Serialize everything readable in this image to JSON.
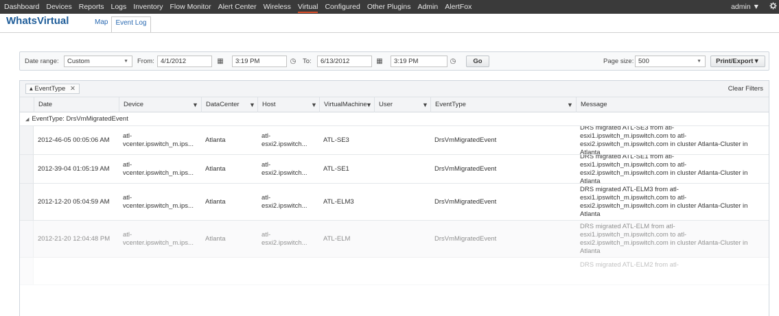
{
  "nav": {
    "items": [
      "Dashboard",
      "Devices",
      "Reports",
      "Logs",
      "Inventory",
      "Flow Monitor",
      "Alert Center",
      "Wireless",
      "Virtual",
      "Configured",
      "Other Plugins",
      "Admin",
      "AlertFox"
    ],
    "active_index": 8,
    "user": "admin ▼",
    "settings_icon": "gear-icon"
  },
  "header": {
    "brand": "WhatsVirtual",
    "tabs": [
      "Map",
      "Event Log"
    ],
    "active_tab": 1
  },
  "toolbar": {
    "date_range_label": "Date range:",
    "date_range_value": "Custom",
    "from_label": "From:",
    "from_date": "4/1/2012",
    "from_time": "3:19 PM",
    "to_label": "To:",
    "to_date": "6/13/2012",
    "to_time": "3:19 PM",
    "go_label": "Go",
    "page_size_label": "Page size:",
    "page_size_value": "500",
    "print_export_label": "Print/Export▼"
  },
  "grid": {
    "group_chip": "EventType",
    "group_chip_prefix": "▴",
    "group_chip_close": "✕",
    "clear_filters": "Clear Filters",
    "columns": [
      "Date",
      "Device",
      "DataCenter",
      "Host",
      "VirtualMachine",
      "User",
      "EventType",
      "Message"
    ],
    "group_label": "EventType: DrsVmMigratedEvent",
    "rows": [
      {
        "date": "2012-46-05 00:05:06 AM",
        "device_line1": "atl-",
        "device_line2": "vcenter.ipswitch_m.ips...",
        "datacenter": "Atlanta",
        "host_line1": "atl-",
        "host_line2": "esxi2.ipswitch...",
        "vm": "ATL-SE3",
        "user": "",
        "eventtype": "DrsVmMigratedEvent",
        "message": "DRS migrated ATL-SE3 from atl-esxi1.ipswitch_m.ipswitch.com to atl-esxi2.ipswitch_m.ipswitch.com in cluster Atlanta-Cluster in Atlanta"
      },
      {
        "date": "2012-39-04 01:05:19 AM",
        "device_line1": "atl-",
        "device_line2": "vcenter.ipswitch_m.ips...",
        "datacenter": "Atlanta",
        "host_line1": "atl-",
        "host_line2": "esxi2.ipswitch...",
        "vm": "ATL-SE1",
        "user": "",
        "eventtype": "DrsVmMigratedEvent",
        "message": "DRS migrated ATL-SE1 from atl-esxi1.ipswitch_m.ipswitch.com to atl-esxi2.ipswitch_m.ipswitch.com in cluster Atlanta-Cluster in Atlanta"
      },
      {
        "date": "2012-12-20 05:04:59 AM",
        "device_line1": "atl-",
        "device_line2": "vcenter.ipswitch_m.ips...",
        "datacenter": "Atlanta",
        "host_line1": "atl-",
        "host_line2": "esxi2.ipswitch...",
        "vm": "ATL-ELM3",
        "user": "",
        "eventtype": "DrsVmMigratedEvent",
        "message": "DRS migrated ATL-ELM3 from atl-esxi1.ipswitch_m.ipswitch.com to atl-esxi2.ipswitch_m.ipswitch.com in cluster Atlanta-Cluster in Atlanta"
      },
      {
        "date": "2012-21-20 12:04:48 PM",
        "device_line1": "atl-",
        "device_line2": "vcenter.ipswitch_m.ips...",
        "datacenter": "Atlanta",
        "host_line1": "atl-",
        "host_line2": "esxi2.ipswitch...",
        "vm": "ATL-ELM",
        "user": "",
        "eventtype": "DrsVmMigratedEvent",
        "message": "DRS migrated ATL-ELM from atl-esxi1.ipswitch_m.ipswitch.com to atl-esxi2.ipswitch_m.ipswitch.com in cluster Atlanta-Cluster in Atlanta"
      },
      {
        "date": "",
        "device_line1": "",
        "device_line2": "",
        "datacenter": "",
        "host_line1": "",
        "host_line2": "",
        "vm": "",
        "user": "",
        "eventtype": "",
        "message": "DRS migrated ATL-ELM2 from atl-"
      }
    ]
  }
}
